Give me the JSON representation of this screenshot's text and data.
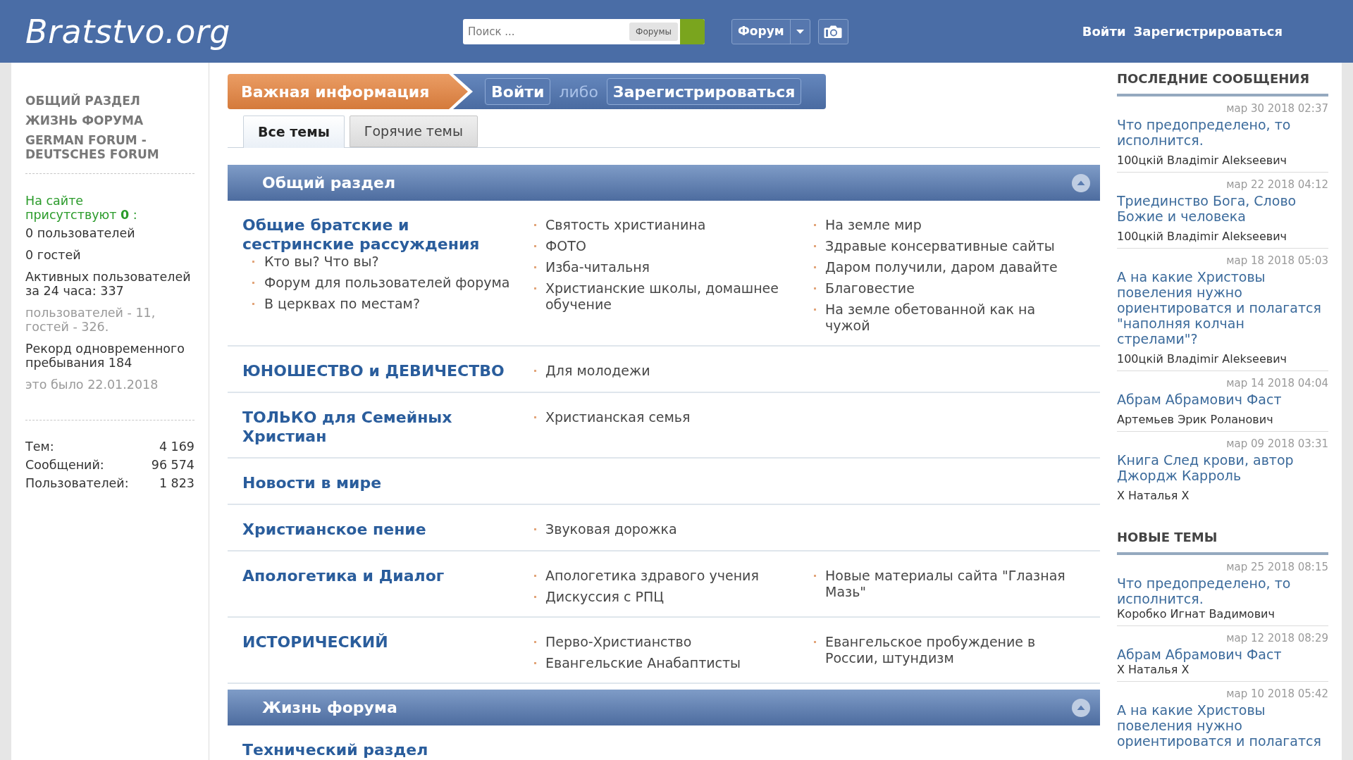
{
  "header": {
    "logo": "Bratstvo.org",
    "search": {
      "placeholder": "Поиск ...",
      "scope": "Форумы"
    },
    "forum_menu": "Форум",
    "auth_links": [
      "Войти",
      "Зарегистрироваться"
    ]
  },
  "sidebar": {
    "categories": [
      "ОБЩИЙ РАЗДЕЛ",
      "ЖИЗНЬ ФОРУМА",
      "GERMAN FORUM - DEUTSCHES FORUM"
    ],
    "online": {
      "heading": "На сайте присутствуют **0** :",
      "lines": [
        {
          "text": "0 пользователей",
          "muted": false
        },
        {
          "text": "0 гостей",
          "muted": false
        },
        {
          "text": "Активных пользователей за 24 часа: 337",
          "muted": false
        },
        {
          "text": "пользователей - 11, гостей - 326.",
          "muted": true
        },
        {
          "text": "Рекорд одновременного пребывания 184",
          "muted": false
        },
        {
          "text": "это было 22.01.2018",
          "muted": true
        }
      ]
    },
    "stats": [
      {
        "label": "Тем:",
        "value": "4 169"
      },
      {
        "label": "Сообщений:",
        "value": "96 574"
      },
      {
        "label": "Пользователей:",
        "value": "1 823"
      }
    ]
  },
  "notice": {
    "title": "Важная информация",
    "login": "Войти",
    "separator": "либо",
    "register": "Зарегистрироваться"
  },
  "tabs": [
    {
      "label": "Все темы",
      "selected": true
    },
    {
      "label": "Горячие темы",
      "selected": false
    }
  ],
  "sections": [
    {
      "title": "Общий раздел",
      "expanded": true,
      "forums": [
        {
          "title": "Общие братские и сестринские рассуждения",
          "subforums_under_title": [
            "Кто вы? Что вы?",
            "Форум для пользователей форума",
            "В церквах по местам?"
          ],
          "subforum_columns": [
            [
              "Святость христианина",
              "ФОТО",
              "Изба-читальня",
              "Христианские школы, домашнее обучение"
            ],
            [
              "На земле мир",
              "Здравые консервативные сайты",
              "Даром получили, даром давайте",
              "Благовестие",
              "На земле обетованной как на чужой"
            ]
          ]
        },
        {
          "title": "ЮНОШЕСТВО и ДЕВИЧЕСТВО",
          "subforum_columns": [
            [
              "Для молодежи"
            ]
          ]
        },
        {
          "title": "ТОЛЬКО для Семейных Христиан",
          "subforum_columns": [
            [
              "Христианская семья"
            ]
          ]
        },
        {
          "title": "Новости в мире"
        },
        {
          "title": "Христианское пение",
          "subforum_columns": [
            [
              "Звуковая дорожка"
            ]
          ]
        },
        {
          "title": "Апологетика и Диалог",
          "subforum_columns": [
            [
              "Апологетика здравого учения",
              "Дискуссия с РПЦ"
            ],
            [
              "Новые материалы сайта \"Глазная Мазь\""
            ]
          ]
        },
        {
          "title": "ИСТОРИЧЕСКИЙ",
          "subforum_columns": [
            [
              "Перво-Христианство",
              "Евангельские Анабаптисты"
            ],
            [
              "Евангельское пробуждение в России, штундизм"
            ]
          ]
        }
      ]
    },
    {
      "title": "Жизнь форума",
      "expanded": true,
      "forums": [
        {
          "title": "Технический раздел"
        }
      ]
    }
  ],
  "latest_posts": {
    "heading": "ПОСЛЕДНИЕ СООБЩЕНИЯ",
    "items": [
      {
        "date": "мар 30 2018 02:37",
        "title": "Что предопределено, то исполнится.",
        "author": "100цкій Владimir Alekseeвич"
      },
      {
        "date": "мар 22 2018 04:12",
        "title": "Триединство Бога, Слово Божие и человека",
        "author": "100цкій Владimir Alekseeвич"
      },
      {
        "date": "мар 18 2018 05:03",
        "title": "А на какие Христовы повеления нужно ориентироватся и полагатся \"наполняя колчан стрелами\"?",
        "author": "100цкій Владimir Alekseeвич"
      },
      {
        "date": "мар 14 2018 04:04",
        "title": "Абрам Абрамович Фаст",
        "author": "Артемьев Эрик Роланович"
      },
      {
        "date": "мар 09 2018 03:31",
        "title": "Книга След крови, автор Джордж Карроль",
        "author": "Х Наталья Х"
      }
    ]
  },
  "new_topics": {
    "heading": "НОВЫЕ ТЕМЫ",
    "items": [
      {
        "date": "мар 25 2018 08:15",
        "title": "Что предопределено, то исполнится.",
        "author": "Коробко Игнат Вадимович"
      },
      {
        "date": "мар 12 2018 08:29",
        "title": "Абрам Абрамович Фаст",
        "author": "Х Наталья Х"
      },
      {
        "date": "мар 10 2018 05:42",
        "title": "А на какие Христовы повеления нужно ориентироватся и полагатся"
      }
    ]
  }
}
